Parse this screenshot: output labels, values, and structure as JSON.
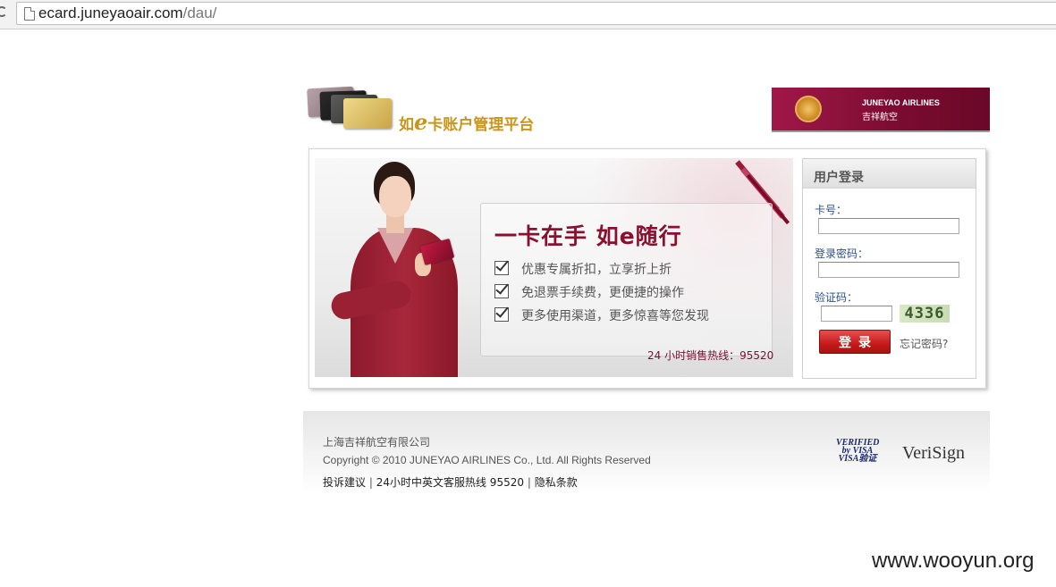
{
  "browser": {
    "url_domain": "ecard.juneyaoair.com",
    "url_path": "/dau/"
  },
  "header": {
    "logo_prefix": "如",
    "logo_e": "e",
    "logo_suffix": "卡账户管理平台",
    "airline_name_en": "JUNEYAO AIRLINES",
    "airline_name_cn": "吉祥航空"
  },
  "promo": {
    "slogan": "一卡在手 如e随行",
    "features": [
      "优惠专属折扣，立享折上折",
      "免退票手续费，更便捷的操作",
      "更多使用渠道，更多惊喜等您发现"
    ],
    "hotline": "24 小时销售热线：95520"
  },
  "login": {
    "title": "用户登录",
    "card_label": "卡号：",
    "card_value": "",
    "password_label": "登录密码：",
    "password_value": "",
    "captcha_label": "验证码：",
    "captcha_value": "",
    "captcha_image_text": "4336",
    "submit_label": "登录",
    "forgot_label": "忘记密码?"
  },
  "footer": {
    "company": "上海吉祥航空有限公司",
    "copyright": "Copyright © 2010 JUNEYAO AIRLINES Co., Ltd. All Rights Reserved",
    "links": [
      "投诉建议",
      "24小时中英文客服热线 95520",
      "隐私条款"
    ],
    "link_separator": "|",
    "badge_visa_line1": "VERIFIED",
    "badge_visa_line2": "by VISA",
    "badge_visa_line3": "VISA验证",
    "badge_verisign": "VeriSign"
  },
  "watermark": "www.wooyun.org",
  "colors": {
    "brand_maroon": "#8b1030",
    "login_button": "#c41a1a",
    "label_blue": "#2a4f8a",
    "gold": "#c8961e"
  }
}
